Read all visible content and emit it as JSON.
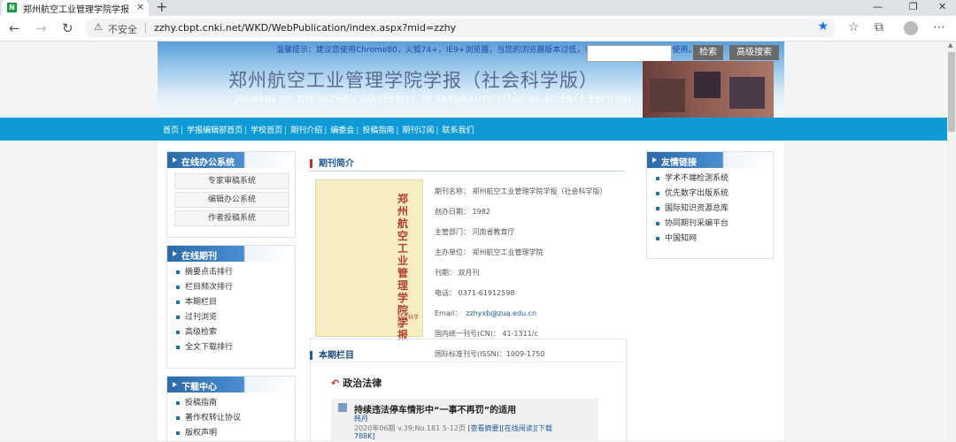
{
  "browser": {
    "tab_title": "郑州航空工业管理学院学报（社…",
    "tab_close": "×",
    "new_tab": "+",
    "win_min": "—",
    "win_max": "❐",
    "win_close": "✕",
    "back": "←",
    "forward": "→",
    "reload": "↻",
    "security_label": "不安全",
    "url": "zzhy.cbpt.cnki.net/WKD/WebPublication/index.aspx?mid=zzhy",
    "star": "★"
  },
  "banner": {
    "notice": "温馨提示：建议您使用Chrome80，火狐74+，IE9+浏览器，当您的浏览器版本过低，可能会影响部分功能正常使用。",
    "search_button": "检索",
    "advanced_search_button": "高级搜索",
    "title_cn": "郑州航空工业管理学院学报（社会科学版）",
    "title_en": "JOURANL OF ZHENGZHOU UNIVERSITY OF AERONAUTICS(SOCIAL SCIENCE EDITION)"
  },
  "nav": {
    "items": [
      "首页",
      "学报编辑部首页",
      "学校首页",
      "期刊介绍",
      "编委会",
      "投稿指南",
      "期刊订阅",
      "联系我们"
    ],
    "separator": "|"
  },
  "left": {
    "office": {
      "title": "在线办公系统",
      "buttons": [
        "专家审稿系统",
        "编辑办公系统",
        "作者投稿系统"
      ]
    },
    "journal": {
      "title": "在线期刊",
      "items": [
        "摘要点击排行",
        "栏目频次排行",
        "本期栏目",
        "过刊浏览",
        "高级检索",
        "全文下载排行"
      ]
    },
    "download": {
      "title": "下载中心",
      "items": [
        "投稿指南",
        "著作权转让协议",
        "版权声明"
      ]
    }
  },
  "center": {
    "intro_title": "期刊简介",
    "cover_title": "郑州航空工业管理学院学报",
    "cover_sub": "社会科学版",
    "info": {
      "name": "期刊名称：  郑州航空工业管理学院学报（社会科学版）",
      "founded": "创办日期：  1982",
      "supervisor": "主管部门：  河南省教育厅",
      "sponsor": "主办单位：  郑州航空工业管理学院",
      "period": "刊期：  双月刊",
      "phone": "电话：  0371-61912598",
      "email_label": "Email：",
      "email": "zzhyxb@zua.edu.cn",
      "cn": "国内统一刊号(CN)：  41-1311/c",
      "issn": "国际标准刊号(ISSN)：1009-1750"
    },
    "current_title": "本期栏目",
    "column_name": "政治法律",
    "article": {
      "title": "持续违法停车情形中“一事不再罚”的适用",
      "author": "韩月",
      "meta": "2020年06期 v.39;No.181 5-12页",
      "link_abstract": "[查看摘要]",
      "link_read": "[在线阅读]",
      "link_download": "[下载",
      "size": "788K]"
    }
  },
  "right": {
    "links": {
      "title": "友情链接",
      "items": [
        "学术不端检测系统",
        "优先数字出版系统",
        "国际知识资源总库",
        "协同期刊采编平台",
        "中国知网"
      ]
    }
  },
  "colors": {
    "nav_blue": "#0e9ad6",
    "box_header": "#2c6aa8",
    "accent_red": "#c92f2f"
  }
}
